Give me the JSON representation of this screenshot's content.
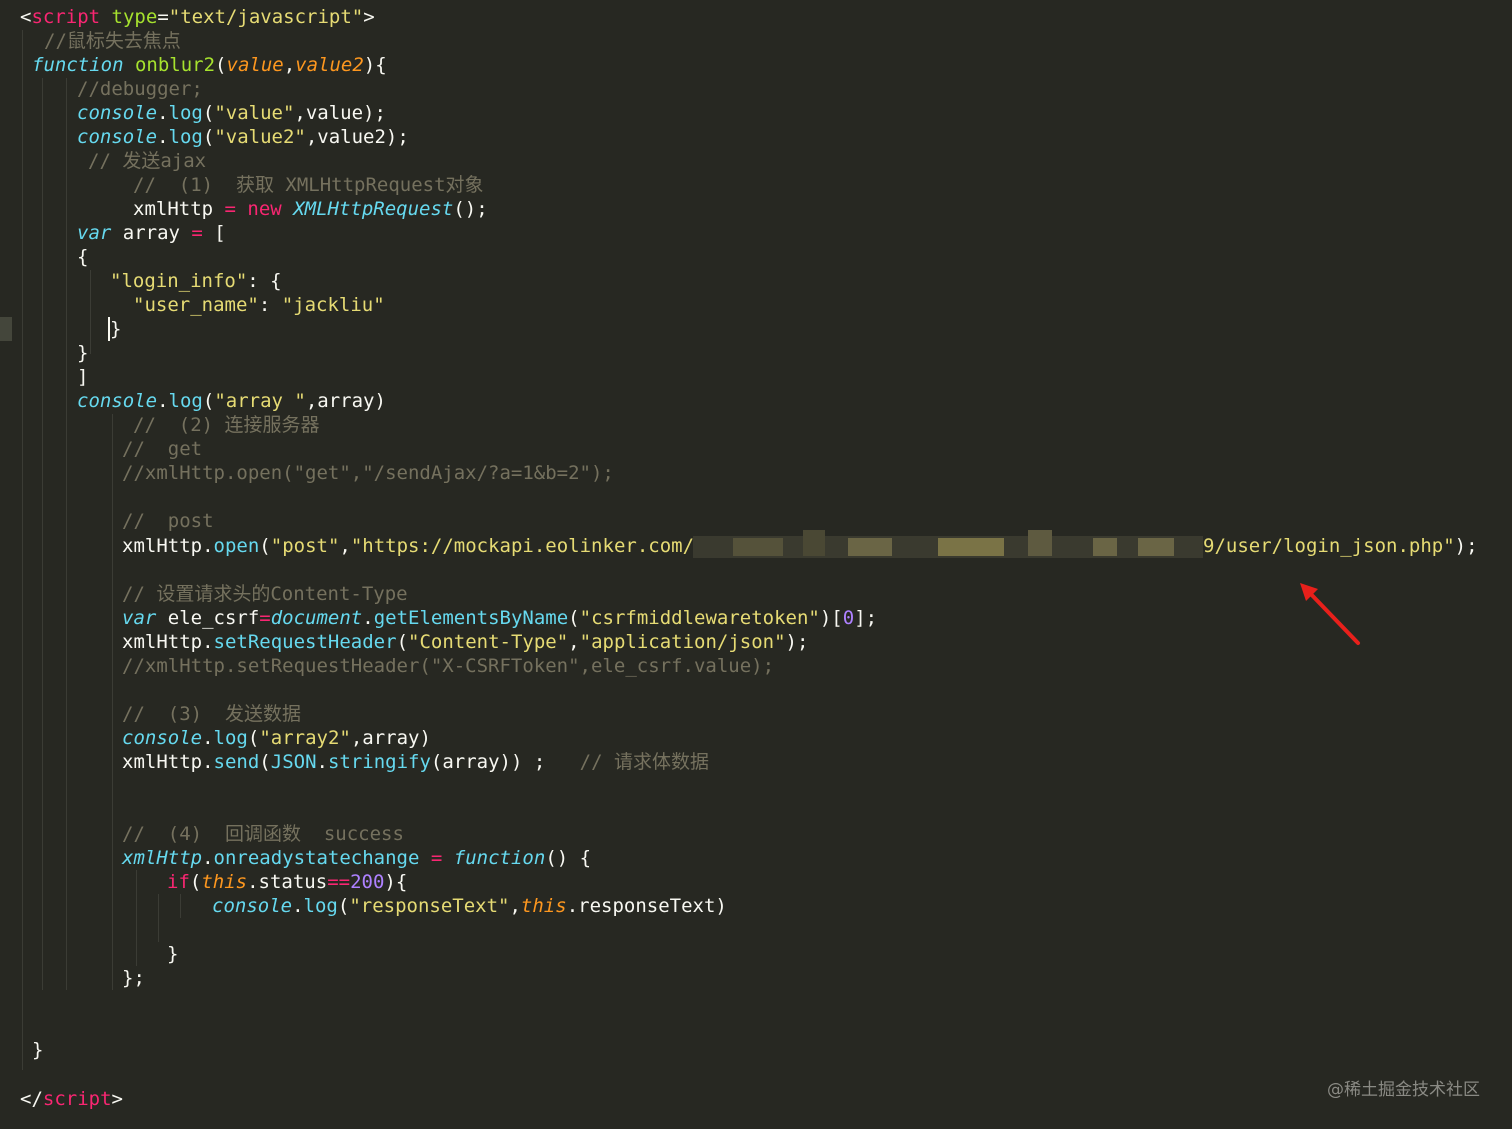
{
  "editor": {
    "background": "#272822",
    "lines": [
      [
        {
          "t": "<",
          "c": "plain"
        },
        {
          "t": "script",
          "c": "tag"
        },
        {
          "t": " ",
          "c": "plain"
        },
        {
          "t": "type",
          "c": "attr"
        },
        {
          "t": "=",
          "c": "plain"
        },
        {
          "t": "\"text/javascript\"",
          "c": "string"
        },
        {
          "t": ">",
          "c": "plain"
        }
      ],
      [
        {
          "t": "//鼠标失去焦点",
          "c": "comment"
        }
      ],
      [
        {
          "t": "function",
          "c": "storage"
        },
        {
          "t": " ",
          "c": "plain"
        },
        {
          "t": "onblur2",
          "c": "func"
        },
        {
          "t": "(",
          "c": "plain"
        },
        {
          "t": "value",
          "c": "param"
        },
        {
          "t": ",",
          "c": "plain"
        },
        {
          "t": "value2",
          "c": "param"
        },
        {
          "t": "){",
          "c": "plain"
        }
      ],
      [
        {
          "t": "//debugger;",
          "c": "comment"
        }
      ],
      [
        {
          "t": "console",
          "c": "builtin"
        },
        {
          "t": ".",
          "c": "plain"
        },
        {
          "t": "log",
          "c": "method"
        },
        {
          "t": "(",
          "c": "plain"
        },
        {
          "t": "\"value\"",
          "c": "string"
        },
        {
          "t": ",value);",
          "c": "plain"
        }
      ],
      [
        {
          "t": "console",
          "c": "builtin"
        },
        {
          "t": ".",
          "c": "plain"
        },
        {
          "t": "log",
          "c": "method"
        },
        {
          "t": "(",
          "c": "plain"
        },
        {
          "t": "\"value2\"",
          "c": "string"
        },
        {
          "t": ",value2);",
          "c": "plain"
        }
      ],
      [
        {
          "t": "// 发送ajax",
          "c": "comment"
        }
      ],
      [
        {
          "t": "//  (1)  获取 XMLHttpRequest对象",
          "c": "comment"
        }
      ],
      [
        {
          "t": "xmlHttp ",
          "c": "plain"
        },
        {
          "t": "=",
          "c": "op"
        },
        {
          "t": " ",
          "c": "plain"
        },
        {
          "t": "new",
          "c": "keyword"
        },
        {
          "t": " ",
          "c": "plain"
        },
        {
          "t": "XMLHttpRequest",
          "c": "builtin"
        },
        {
          "t": "();",
          "c": "plain"
        }
      ],
      [
        {
          "t": "var",
          "c": "storage"
        },
        {
          "t": " array ",
          "c": "plain"
        },
        {
          "t": "=",
          "c": "op"
        },
        {
          "t": " [",
          "c": "plain"
        }
      ],
      [
        {
          "t": "{",
          "c": "plain"
        }
      ],
      [
        {
          "t": "\"login_info\"",
          "c": "string"
        },
        {
          "t": ": {",
          "c": "plain"
        }
      ],
      [
        {
          "t": "\"user_name\"",
          "c": "string"
        },
        {
          "t": ": ",
          "c": "plain"
        },
        {
          "t": "\"jackliu\"",
          "c": "string"
        }
      ],
      [
        {
          "t": "}",
          "c": "plain"
        }
      ],
      [
        {
          "t": "}",
          "c": "plain"
        }
      ],
      [
        {
          "t": "]",
          "c": "plain"
        }
      ],
      [
        {
          "t": "console",
          "c": "builtin"
        },
        {
          "t": ".",
          "c": "plain"
        },
        {
          "t": "log",
          "c": "method"
        },
        {
          "t": "(",
          "c": "plain"
        },
        {
          "t": "\"array \"",
          "c": "string"
        },
        {
          "t": ",array)",
          "c": "plain"
        }
      ],
      [
        {
          "t": "//  (2) 连接服务器",
          "c": "comment"
        }
      ],
      [
        {
          "t": "//  get",
          "c": "comment"
        }
      ],
      [
        {
          "t": "//xmlHttp.open(\"get\",\"/sendAjax/?a=1&b=2\");",
          "c": "comment"
        }
      ],
      [
        {
          "t": "//  post",
          "c": "comment"
        }
      ],
      [
        {
          "t": "xmlHttp",
          "c": "plain"
        },
        {
          "t": ".",
          "c": "plain"
        },
        {
          "t": "open",
          "c": "method"
        },
        {
          "t": "(",
          "c": "plain"
        },
        {
          "t": "\"post\"",
          "c": "string"
        },
        {
          "t": ",",
          "c": "plain"
        },
        {
          "t": "\"https://mockapi.eolinker.com/R",
          "c": "string"
        }
      ],
      [
        {
          "t": "9/user/login_json.php\"",
          "c": "string"
        },
        {
          "t": ");",
          "c": "plain"
        }
      ],
      [
        {
          "t": "// 设置请求头的Content-Type",
          "c": "comment"
        }
      ],
      [
        {
          "t": "var",
          "c": "storage"
        },
        {
          "t": " ele_csrf",
          "c": "plain"
        },
        {
          "t": "=",
          "c": "op"
        },
        {
          "t": "document",
          "c": "builtin"
        },
        {
          "t": ".",
          "c": "plain"
        },
        {
          "t": "getElementsByName",
          "c": "method"
        },
        {
          "t": "(",
          "c": "plain"
        },
        {
          "t": "\"csrfmiddlewaretoken\"",
          "c": "string"
        },
        {
          "t": ")[",
          "c": "plain"
        },
        {
          "t": "0",
          "c": "number"
        },
        {
          "t": "];",
          "c": "plain"
        }
      ],
      [
        {
          "t": "xmlHttp",
          "c": "plain"
        },
        {
          "t": ".",
          "c": "plain"
        },
        {
          "t": "setRequestHeader",
          "c": "method"
        },
        {
          "t": "(",
          "c": "plain"
        },
        {
          "t": "\"Content-Type\"",
          "c": "string"
        },
        {
          "t": ",",
          "c": "plain"
        },
        {
          "t": "\"application/json\"",
          "c": "string"
        },
        {
          "t": ");",
          "c": "plain"
        }
      ],
      [
        {
          "t": "//xmlHttp.setRequestHeader(\"X-CSRFToken\",ele_csrf.value);",
          "c": "comment"
        }
      ],
      [
        {
          "t": "//  (3)  发送数据",
          "c": "comment"
        }
      ],
      [
        {
          "t": "console",
          "c": "builtin"
        },
        {
          "t": ".",
          "c": "plain"
        },
        {
          "t": "log",
          "c": "method"
        },
        {
          "t": "(",
          "c": "plain"
        },
        {
          "t": "\"array2\"",
          "c": "string"
        },
        {
          "t": ",array)",
          "c": "plain"
        }
      ],
      [
        {
          "t": "xmlHttp",
          "c": "plain"
        },
        {
          "t": ".",
          "c": "plain"
        },
        {
          "t": "send",
          "c": "method"
        },
        {
          "t": "(",
          "c": "plain"
        },
        {
          "t": "JSON",
          "c": "method"
        },
        {
          "t": ".",
          "c": "plain"
        },
        {
          "t": "stringify",
          "c": "method"
        },
        {
          "t": "(array)) ;   ",
          "c": "plain"
        },
        {
          "t": "// 请求体数据",
          "c": "comment"
        }
      ],
      [
        {
          "t": "//  (4)  回调函数  success",
          "c": "comment"
        }
      ],
      [
        {
          "t": "xmlHttp",
          "c": "builtin"
        },
        {
          "t": ".",
          "c": "plain"
        },
        {
          "t": "onreadystatechange",
          "c": "method"
        },
        {
          "t": " ",
          "c": "plain"
        },
        {
          "t": "=",
          "c": "op"
        },
        {
          "t": " ",
          "c": "plain"
        },
        {
          "t": "function",
          "c": "storage"
        },
        {
          "t": "() {",
          "c": "plain"
        }
      ],
      [
        {
          "t": "if",
          "c": "keyword"
        },
        {
          "t": "(",
          "c": "plain"
        },
        {
          "t": "this",
          "c": "this"
        },
        {
          "t": ".status",
          "c": "plain"
        },
        {
          "t": "==",
          "c": "op"
        },
        {
          "t": "200",
          "c": "number"
        },
        {
          "t": "){",
          "c": "plain"
        }
      ],
      [
        {
          "t": "console",
          "c": "builtin"
        },
        {
          "t": ".",
          "c": "plain"
        },
        {
          "t": "log",
          "c": "method"
        },
        {
          "t": "(",
          "c": "plain"
        },
        {
          "t": "\"responseText\"",
          "c": "string"
        },
        {
          "t": ",",
          "c": "plain"
        },
        {
          "t": "this",
          "c": "this"
        },
        {
          "t": ".responseText)",
          "c": "plain"
        }
      ],
      [
        {
          "t": "}",
          "c": "plain"
        }
      ],
      [
        {
          "t": "};",
          "c": "plain"
        }
      ],
      [
        {
          "t": "}",
          "c": "plain"
        }
      ],
      [
        {
          "t": "</",
          "c": "plain"
        },
        {
          "t": "script",
          "c": "tag"
        },
        {
          "t": ">",
          "c": "plain"
        }
      ]
    ]
  },
  "annotation": {
    "arrow_color": "#e8201b"
  },
  "watermark": {
    "text": "@稀土掘金技术社区"
  }
}
